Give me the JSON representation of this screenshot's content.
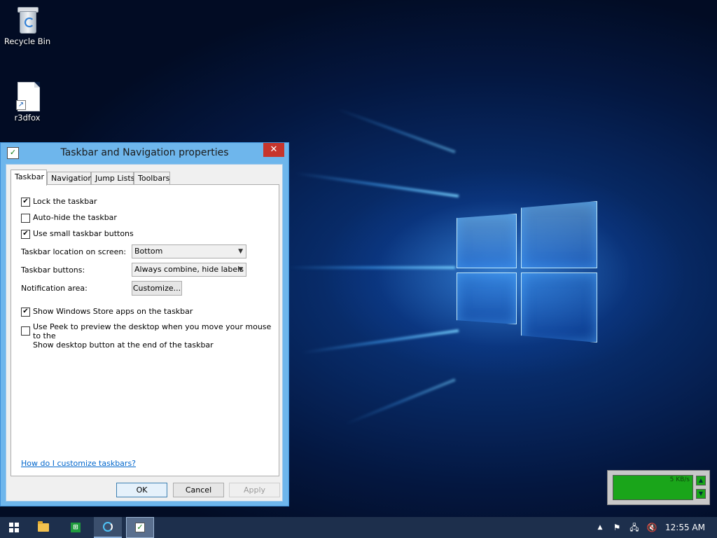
{
  "desktop": {
    "icons": [
      {
        "label": "Recycle Bin",
        "icon": "recycle-bin-icon"
      },
      {
        "label": "r3dfox",
        "icon": "file-shortcut-icon"
      }
    ]
  },
  "dialog": {
    "title": "Taskbar and Navigation properties",
    "close_glyph": "✕",
    "tabs": [
      {
        "label": "Taskbar",
        "active": true
      },
      {
        "label": "Navigation",
        "active": false
      },
      {
        "label": "Jump Lists",
        "active": false
      },
      {
        "label": "Toolbars",
        "active": false
      }
    ],
    "options": {
      "lock_taskbar": {
        "label": "Lock the taskbar",
        "checked": true,
        "mark": "✔"
      },
      "auto_hide": {
        "label": "Auto-hide the taskbar",
        "checked": false,
        "mark": ""
      },
      "small_buttons": {
        "label": "Use small taskbar buttons",
        "checked": true,
        "mark": "✔"
      },
      "store_apps": {
        "label": "Show Windows Store apps on the taskbar",
        "checked": true,
        "mark": "✔"
      },
      "peek": {
        "label_line1": "Use Peek to preview the desktop when you move your mouse to the",
        "label_line2": "Show desktop button at the end of the taskbar",
        "checked": false,
        "mark": ""
      }
    },
    "location": {
      "label": "Taskbar location on screen:",
      "value": "Bottom"
    },
    "buttons_setting": {
      "label": "Taskbar buttons:",
      "value": "Always combine, hide labels"
    },
    "notification": {
      "label": "Notification area:",
      "button": "Customize..."
    },
    "help_link": "How do I customize taskbars?",
    "ok": "OK",
    "cancel": "Cancel",
    "apply": "Apply"
  },
  "widget": {
    "value": "5 KB/s"
  },
  "taskbar": {
    "items": [
      "start-button",
      "file-explorer",
      "store",
      "app-circle",
      "taskbar-properties"
    ],
    "tray_overflow": "▲",
    "clock": "12:55 AM"
  },
  "colors": {
    "titlebar": "#6eb6ec",
    "close": "#c7352c",
    "taskbar": "#1d2f4c",
    "link": "#0066cc"
  }
}
